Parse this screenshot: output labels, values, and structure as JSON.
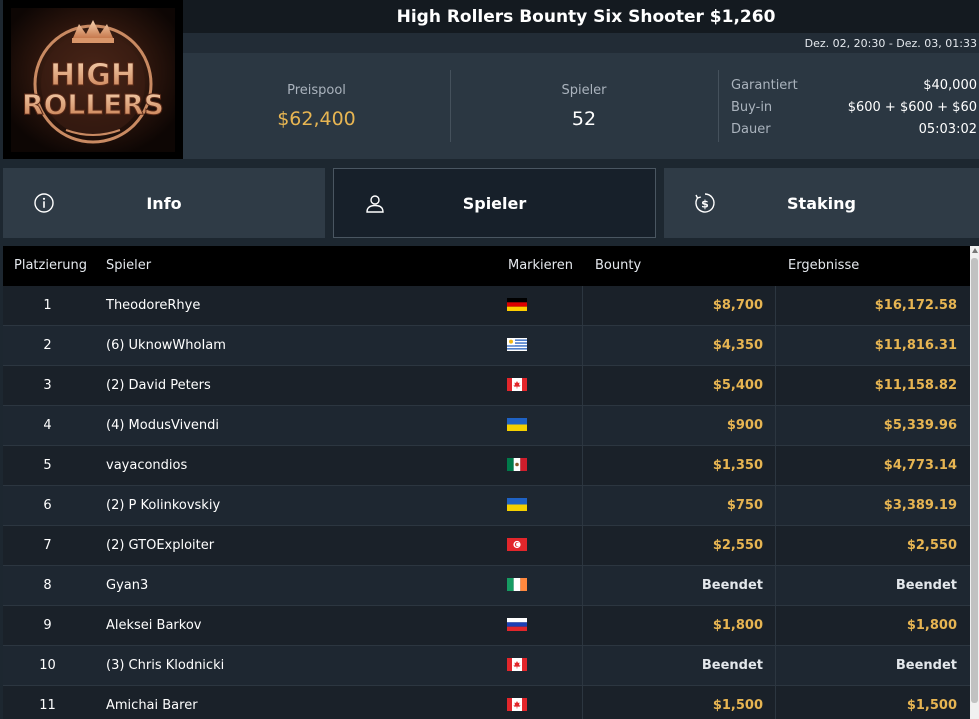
{
  "header": {
    "logo": {
      "line1": "HIGH",
      "line2": "ROLLERS"
    },
    "title": "High Rollers Bounty Six Shooter $1,260",
    "date_range": "Dez. 02, 20:30 - Dez. 03, 01:33",
    "prizepool_label": "Preispool",
    "prizepool_value": "$62,400",
    "players_label": "Spieler",
    "players_value": "52",
    "details": [
      {
        "key": "Garantiert",
        "value": "$40,000"
      },
      {
        "key": "Buy-in",
        "value": "$600 + $600 + $60"
      },
      {
        "key": "Dauer",
        "value": "05:03:02"
      }
    ]
  },
  "tabs": [
    {
      "label": "Info",
      "icon": "info-icon",
      "active": false
    },
    {
      "label": "Spieler",
      "icon": "user-icon",
      "active": true
    },
    {
      "label": "Staking",
      "icon": "staking-dollar-icon",
      "active": false
    }
  ],
  "table": {
    "columns": [
      "Platzierung",
      "Spieler",
      "Markieren",
      "Bounty",
      "Ergebnisse"
    ],
    "rows": [
      {
        "place": "1",
        "name": "TheodoreRhye",
        "flag": "germany",
        "bounty": "$8,700",
        "result": "$16,172.58"
      },
      {
        "place": "2",
        "name": "(6) UknowWhoIam",
        "flag": "uruguay",
        "bounty": "$4,350",
        "result": "$11,816.31"
      },
      {
        "place": "3",
        "name": "(2) David Peters",
        "flag": "canada",
        "bounty": "$5,400",
        "result": "$11,158.82"
      },
      {
        "place": "4",
        "name": "(4) ModusVivendi",
        "flag": "ukraine",
        "bounty": "$900",
        "result": "$5,339.96"
      },
      {
        "place": "5",
        "name": "vayacondios",
        "flag": "mexico",
        "bounty": "$1,350",
        "result": "$4,773.14"
      },
      {
        "place": "6",
        "name": "(2) P Kolinkovskiy",
        "flag": "ukraine",
        "bounty": "$750",
        "result": "$3,389.19"
      },
      {
        "place": "7",
        "name": "(2) GTOExploiter",
        "flag": "tunisia",
        "bounty": "$2,550",
        "result": "$2,550"
      },
      {
        "place": "8",
        "name": "Gyan3",
        "flag": "ireland",
        "bounty": "Beendet",
        "result": "Beendet"
      },
      {
        "place": "9",
        "name": "Aleksei Barkov",
        "flag": "russia",
        "bounty": "$1,800",
        "result": "$1,800"
      },
      {
        "place": "10",
        "name": "(3) Chris Klodnicki",
        "flag": "canada",
        "bounty": "Beendet",
        "result": "Beendet"
      },
      {
        "place": "11",
        "name": "Amichai Barer",
        "flag": "canada",
        "bounty": "$1,500",
        "result": "$1,500"
      }
    ]
  },
  "colors": {
    "gold": "#e7b552",
    "background": "#1d2730",
    "header_dark": "#141a20",
    "tab_bg": "#2f3b46"
  }
}
